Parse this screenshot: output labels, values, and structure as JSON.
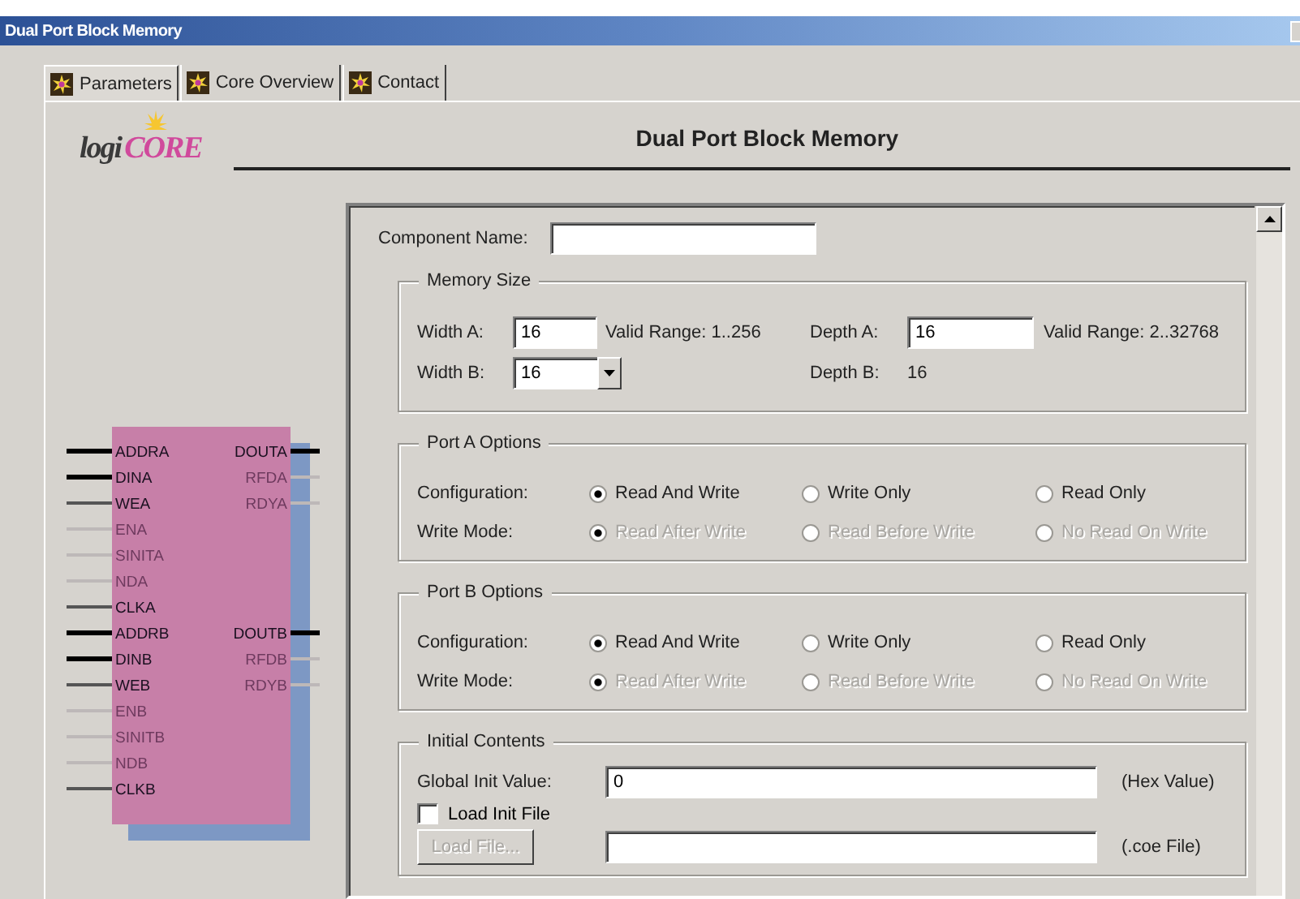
{
  "window": {
    "title": "Dual Port Block Memory"
  },
  "tabs": [
    {
      "label": "Parameters",
      "selected": true
    },
    {
      "label": "Core Overview",
      "selected": false
    },
    {
      "label": "Contact",
      "selected": false
    }
  ],
  "logo": {
    "parts": [
      {
        "text": "logi",
        "color": "#3a3a3a"
      },
      {
        "text": "CORE",
        "color": "#d04a9c"
      }
    ]
  },
  "heading": "Dual Port Block Memory",
  "symbol": {
    "rows": [
      {
        "left": {
          "label": "ADDRA",
          "enabled": true,
          "bus": true
        },
        "right": {
          "label": "DOUTA",
          "enabled": true,
          "bus": true
        }
      },
      {
        "left": {
          "label": "DINA",
          "enabled": true,
          "bus": true
        },
        "right": {
          "label": "RFDA",
          "enabled": false,
          "bus": false
        }
      },
      {
        "left": {
          "label": "WEA",
          "enabled": true,
          "bus": false
        },
        "right": {
          "label": "RDYA",
          "enabled": false,
          "bus": false
        }
      },
      {
        "left": {
          "label": "ENA",
          "enabled": false,
          "bus": false
        }
      },
      {
        "left": {
          "label": "SINITA",
          "enabled": false,
          "bus": false
        }
      },
      {
        "left": {
          "label": "NDA",
          "enabled": false,
          "bus": false
        }
      },
      {
        "left": {
          "label": "CLKA",
          "enabled": true,
          "bus": false
        }
      },
      {
        "left": {
          "label": "ADDRB",
          "enabled": true,
          "bus": true
        },
        "right": {
          "label": "DOUTB",
          "enabled": true,
          "bus": true
        }
      },
      {
        "left": {
          "label": "DINB",
          "enabled": true,
          "bus": true
        },
        "right": {
          "label": "RFDB",
          "enabled": false,
          "bus": false
        }
      },
      {
        "left": {
          "label": "WEB",
          "enabled": true,
          "bus": false
        },
        "right": {
          "label": "RDYB",
          "enabled": false,
          "bus": false
        }
      },
      {
        "left": {
          "label": "ENB",
          "enabled": false,
          "bus": false
        }
      },
      {
        "left": {
          "label": "SINITB",
          "enabled": false,
          "bus": false
        }
      },
      {
        "left": {
          "label": "NDB",
          "enabled": false,
          "bus": false
        }
      },
      {
        "left": {
          "label": "CLKB",
          "enabled": true,
          "bus": false
        }
      }
    ]
  },
  "form": {
    "component_name": {
      "label": "Component Name:"
    },
    "memory_size": {
      "title": "Memory Size",
      "width_a": {
        "label": "Width A:",
        "value": "16",
        "range": "Valid Range: 1..256"
      },
      "depth_a": {
        "label": "Depth A:",
        "value": "16",
        "range": "Valid Range: 2..32768"
      },
      "width_b": {
        "label": "Width B:",
        "value": "16"
      },
      "depth_b": {
        "label": "Depth B:",
        "value": "16"
      }
    },
    "port_groups": [
      {
        "title": "Port A Options",
        "rows": [
          {
            "label": "Configuration:",
            "options": [
              {
                "label": "Read And Write",
                "selected": true,
                "disabled": false
              },
              {
                "label": "Write Only",
                "selected": false,
                "disabled": false
              },
              {
                "label": "Read Only",
                "selected": false,
                "disabled": false
              }
            ]
          },
          {
            "label": "Write Mode:",
            "options": [
              {
                "label": "Read After Write",
                "selected": true,
                "disabled": true
              },
              {
                "label": "Read Before Write",
                "selected": false,
                "disabled": true
              },
              {
                "label": "No Read On Write",
                "selected": false,
                "disabled": true
              }
            ]
          }
        ]
      },
      {
        "title": "Port B Options",
        "rows": [
          {
            "label": "Configuration:",
            "options": [
              {
                "label": "Read And Write",
                "selected": true,
                "disabled": false
              },
              {
                "label": "Write Only",
                "selected": false,
                "disabled": false
              },
              {
                "label": "Read Only",
                "selected": false,
                "disabled": false
              }
            ]
          },
          {
            "label": "Write Mode:",
            "options": [
              {
                "label": "Read After Write",
                "selected": true,
                "disabled": true
              },
              {
                "label": "Read Before Write",
                "selected": false,
                "disabled": true
              },
              {
                "label": "No Read On Write",
                "selected": false,
                "disabled": true
              }
            ]
          }
        ]
      }
    ],
    "initial_contents": {
      "title": "Initial Contents",
      "global_init": {
        "label": "Global Init Value:",
        "value": "0",
        "unit": "(Hex Value)"
      },
      "load_init": {
        "label": "Load Init File",
        "checked": false
      },
      "load_file": {
        "label": "Load File...",
        "disabled": true,
        "unit": "(.coe File)"
      }
    }
  }
}
